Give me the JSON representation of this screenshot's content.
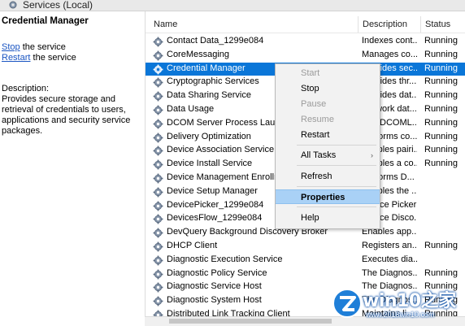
{
  "window": {
    "title": "Services (Local)"
  },
  "left_pane": {
    "service_name": "Credential Manager",
    "actions": [
      {
        "link": "Stop",
        "rest": " the service"
      },
      {
        "link": "Restart",
        "rest": " the service"
      }
    ],
    "description_label": "Description:",
    "description_text": "Provides secure storage and retrieval of credentials to users, applications and security service packages."
  },
  "columns": {
    "name": "Name",
    "description": "Description",
    "status": "Status"
  },
  "rows": [
    {
      "name": "Contact Data_1299e084",
      "description": "Indexes cont...",
      "status": "Running"
    },
    {
      "name": "CoreMessaging",
      "description": "Manages co...",
      "status": "Running"
    },
    {
      "name": "Credential Manager",
      "description": "Provides sec...",
      "status": "Running",
      "selected": true
    },
    {
      "name": "Cryptographic Services",
      "description": "Provides thr...",
      "status": "Running"
    },
    {
      "name": "Data Sharing Service",
      "description": "Provides dat...",
      "status": "Running"
    },
    {
      "name": "Data Usage",
      "description": "Network dat...",
      "status": "Running"
    },
    {
      "name": "DCOM Server Process Launcher",
      "description": "The DCOML...",
      "status": "Running"
    },
    {
      "name": "Delivery Optimization",
      "description": "Performs co...",
      "status": "Running"
    },
    {
      "name": "Device Association Service",
      "description": "Enables pairi...",
      "status": "Running"
    },
    {
      "name": "Device Install Service",
      "description": "Enables a co...",
      "status": "Running"
    },
    {
      "name": "Device Management Enrollment Service",
      "description": "Performs D...",
      "status": ""
    },
    {
      "name": "Device Setup Manager",
      "description": "Enables the ...",
      "status": ""
    },
    {
      "name": "DevicePicker_1299e084",
      "description": "Device Picker",
      "status": ""
    },
    {
      "name": "DevicesFlow_1299e084",
      "description": "Device Disco...",
      "status": ""
    },
    {
      "name": "DevQuery Background Discovery Broker",
      "description": "Enables app...",
      "status": ""
    },
    {
      "name": "DHCP Client",
      "description": "Registers an...",
      "status": "Running"
    },
    {
      "name": "Diagnostic Execution Service",
      "description": "Executes dia...",
      "status": ""
    },
    {
      "name": "Diagnostic Policy Service",
      "description": "The Diagnos...",
      "status": "Running"
    },
    {
      "name": "Diagnostic Service Host",
      "description": "The Diagnos...",
      "status": "Running"
    },
    {
      "name": "Diagnostic System Host",
      "description": "The Diagnos...",
      "status": "Running"
    },
    {
      "name": "Distributed Link Tracking Client",
      "description": "Maintains li...",
      "status": "Running"
    }
  ],
  "context_menu": {
    "start": "Start",
    "stop": "Stop",
    "pause": "Pause",
    "resume": "Resume",
    "restart": "Restart",
    "all_tasks": "All Tasks",
    "refresh": "Refresh",
    "properties": "Properties",
    "help": "Help"
  },
  "watermark": {
    "brand": "win10之家",
    "url": "www.2018win10.com"
  },
  "colors": {
    "selection": "#0a76d8",
    "menu_highlight": "#a9d1f6",
    "link": "#1a55c2",
    "watermark": "#0a4fa8"
  },
  "icons": {
    "service": "gear-icon",
    "submenu": "chevron-right-icon",
    "watermark_logo": "win10-logo-icon"
  }
}
